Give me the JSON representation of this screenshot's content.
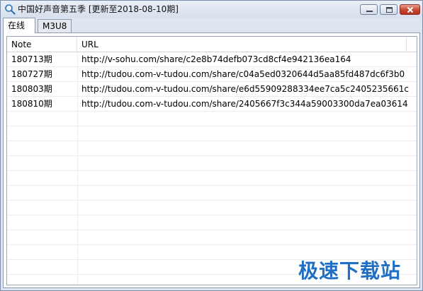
{
  "window": {
    "title": "中国好声音第五季 [更新至2018-08-10期]"
  },
  "tabs": [
    {
      "label": "在线",
      "active": true
    },
    {
      "label": "M3U8",
      "active": false
    }
  ],
  "table": {
    "columns": [
      "Note",
      "URL"
    ],
    "rows": [
      {
        "note": "180713期",
        "url": "http://v-sohu.com/share/c2e8b74defb073cd8cf4e942136ea164"
      },
      {
        "note": "180727期",
        "url": "http://tudou.com-v-tudou.com/share/c04a5ed0320644d5aa85fd487dc6f3b0"
      },
      {
        "note": "180803期",
        "url": "http://tudou.com-v-tudou.com/share/e6d55909288334ee7ca5c2405235661c"
      },
      {
        "note": "180810期",
        "url": "http://tudou.com-v-tudou.com/share/2405667f3c344a59003300da7ea03614"
      }
    ]
  },
  "watermark": {
    "text": "极速下载站",
    "color": "#1f6fc4"
  },
  "icons": {
    "app": "search-icon",
    "minimize": "minimize-icon",
    "maximize": "maximize-icon",
    "close": "close-icon"
  }
}
